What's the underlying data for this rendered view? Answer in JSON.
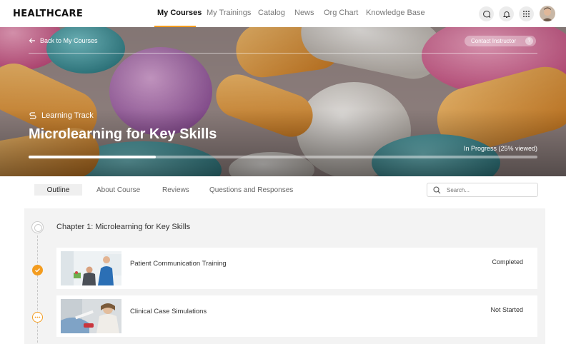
{
  "brand": "HEALTHCARE",
  "nav": {
    "items": [
      "My Courses",
      "My Trainings",
      "Catalog",
      "News",
      "Org Chart",
      "Knowledge Base"
    ],
    "active": "My Courses"
  },
  "header_icons": [
    "chat-icon",
    "bell-icon",
    "apps-grid-icon",
    "user-avatar"
  ],
  "hero": {
    "back_label": "Back to My Courses",
    "contact_label": "Contact Instructor",
    "contact_help": "?",
    "track_label": "Learning Track",
    "title": "Microlearning for Key Skills",
    "progress_text": "In Progress (25% viewed)",
    "progress_fraction": 0.25
  },
  "tabs": [
    "Outline",
    "About Course",
    "Reviews",
    "Questions and Responses"
  ],
  "search": {
    "placeholder": "Search..."
  },
  "chapter": {
    "title": "Chapter 1: Microlearning for Key Skills",
    "lessons": [
      {
        "name": "Patient Communication Training",
        "status": "Completed"
      },
      {
        "name": "Clinical Case Simulations",
        "status": "Not Started"
      }
    ]
  },
  "colors": {
    "accent": "#f39c1f",
    "panel": "#f3f3f3"
  }
}
